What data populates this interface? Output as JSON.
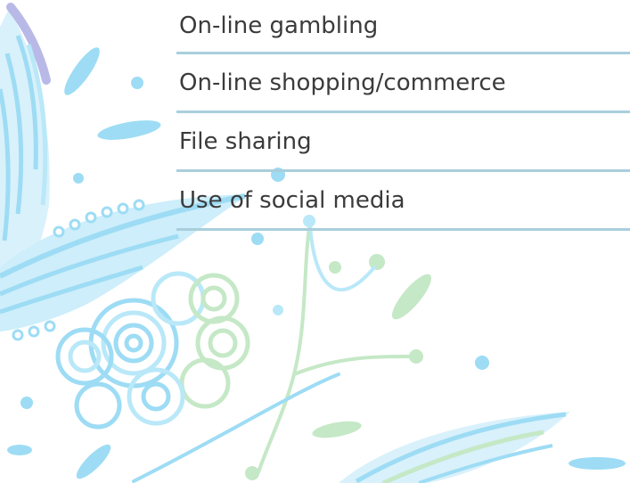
{
  "items": [
    {
      "label": "On-line gambling"
    },
    {
      "label": "On-line shopping/commerce"
    },
    {
      "label": "File sharing"
    },
    {
      "label": "Use of social media"
    }
  ],
  "colors": {
    "divider": "#a9cfdc",
    "text": "#3b3b3b",
    "decor_blue": "#9ddcf4",
    "decor_light_blue": "#b9e8f8",
    "decor_green": "#c5e8c6",
    "decor_purple": "#b9b9e8"
  }
}
